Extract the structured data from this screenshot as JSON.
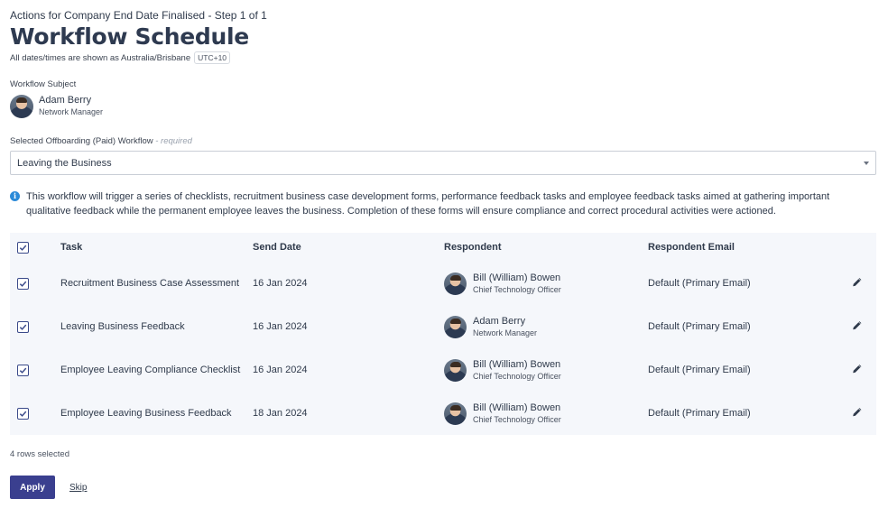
{
  "header": {
    "breadcrumb": "Actions for Company End Date Finalised - Step 1 of 1",
    "title": "Workflow Schedule",
    "timezone_note": "All dates/times are shown as Australia/Brisbane",
    "timezone_badge": "UTC+10"
  },
  "subject": {
    "label": "Workflow Subject",
    "name": "Adam Berry",
    "title": "Network Manager"
  },
  "workflow": {
    "label": "Selected Offboarding (Paid) Workflow",
    "required": "- required",
    "selected": "Leaving the Business"
  },
  "info_text": "This workflow will trigger a series of checklists, recruitment business case development forms, performance feedback tasks and employee feedback tasks aimed at gathering important qualitative feedback while the permanent employee leaves the business. Completion of these forms will ensure compliance and correct procedural activities were actioned.",
  "table": {
    "headers": {
      "task": "Task",
      "send_date": "Send Date",
      "respondent": "Respondent",
      "email": "Respondent Email"
    },
    "rows": [
      {
        "task": "Recruitment Business Case Assessment",
        "date": "16 Jan 2024",
        "resp_name": "Bill (William) Bowen",
        "resp_title": "Chief Technology Officer",
        "email": "Default (Primary Email)"
      },
      {
        "task": "Leaving Business Feedback",
        "date": "16 Jan 2024",
        "resp_name": "Adam Berry",
        "resp_title": "Network Manager",
        "email": "Default (Primary Email)"
      },
      {
        "task": "Employee Leaving Compliance Checklist",
        "date": "16 Jan 2024",
        "resp_name": "Bill (William) Bowen",
        "resp_title": "Chief Technology Officer",
        "email": "Default (Primary Email)"
      },
      {
        "task": "Employee Leaving Business Feedback",
        "date": "18 Jan 2024",
        "resp_name": "Bill (William) Bowen",
        "resp_title": "Chief Technology Officer",
        "email": "Default (Primary Email)"
      }
    ]
  },
  "footer": {
    "rows_selected": "4 rows selected",
    "apply_label": "Apply",
    "skip_label": "Skip"
  },
  "colors": {
    "primary_button": "#3a3f8f",
    "info_icon": "#2b8ad8",
    "table_bg": "#f5f7fb"
  }
}
